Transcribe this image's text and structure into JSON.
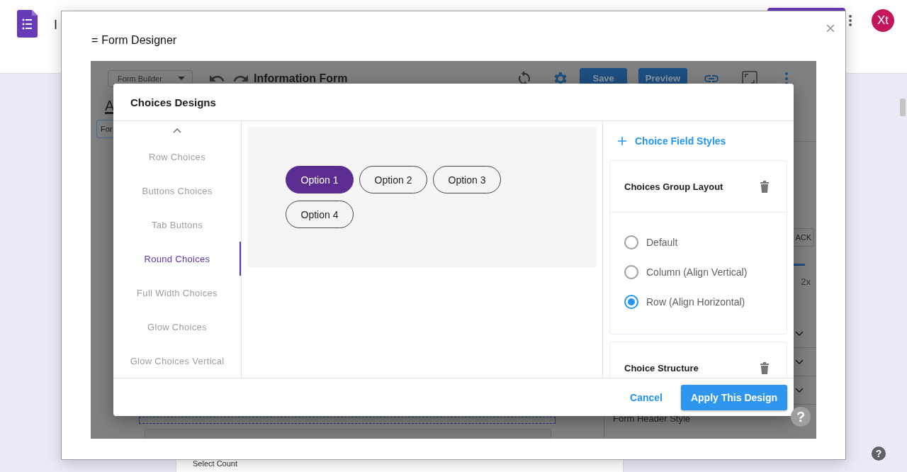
{
  "app_bar": {
    "title": "I",
    "avatar": "Xt"
  },
  "page_card": {
    "text": "Select Count"
  },
  "page_help": "?",
  "modal": {
    "menu_glyph": "=",
    "title": "Form Designer",
    "close": "×"
  },
  "builder": {
    "mode_dropdown": "Form Builder",
    "form_title": "Information Form",
    "buttons": [
      "Save",
      "Preview"
    ],
    "text_color_glyph": "A",
    "field_chip": "For",
    "side_panel": {
      "button": "ACK",
      "zoom": "2x",
      "section": "Form Header Style"
    },
    "help": "?"
  },
  "dialog": {
    "title": "Choices Designs",
    "designs": [
      {
        "label": "Row Choices",
        "selected": false
      },
      {
        "label": "Buttons Choices",
        "selected": false
      },
      {
        "label": "Tab Buttons",
        "selected": false
      },
      {
        "label": "Round Choices",
        "selected": true
      },
      {
        "label": "Full Width Choices",
        "selected": false
      },
      {
        "label": "Glow Choices",
        "selected": false
      },
      {
        "label": "Glow Choices Vertical",
        "selected": false
      }
    ],
    "preview_options": [
      {
        "label": "Option 1",
        "selected": true
      },
      {
        "label": "Option 2",
        "selected": false
      },
      {
        "label": "Option 3",
        "selected": false
      },
      {
        "label": "Option 4",
        "selected": false
      }
    ],
    "styles_action": "Choice Field Styles",
    "groups": [
      {
        "title": "Choices Group Layout",
        "options": [
          {
            "label": "Default",
            "selected": false
          },
          {
            "label": "Column (Align Vertical)",
            "selected": false
          },
          {
            "label": "Row (Align Horizontal)",
            "selected": true
          }
        ]
      },
      {
        "title": "Choice Structure"
      }
    ],
    "buttons": [
      {
        "label": "Cancel",
        "kind": "text"
      },
      {
        "label": "Apply This Design",
        "kind": "primary"
      }
    ]
  }
}
